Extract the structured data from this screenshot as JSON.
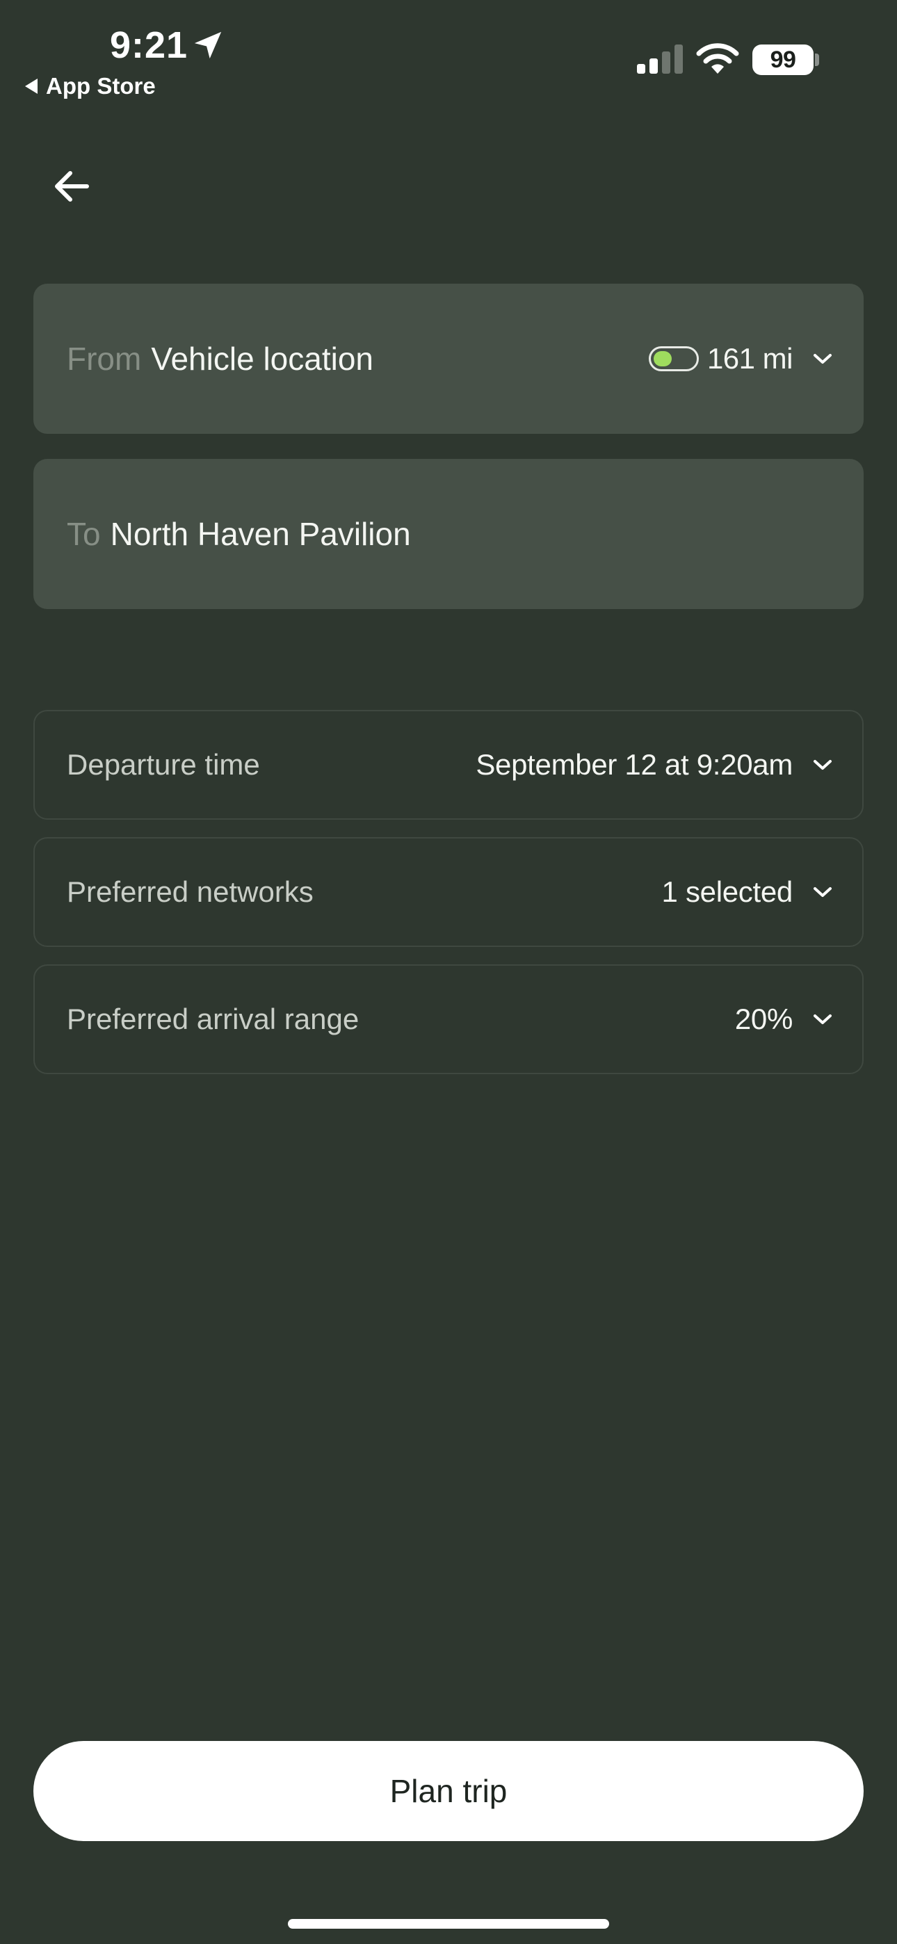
{
  "status_bar": {
    "time": "9:21",
    "back_app": "App Store",
    "battery": "99"
  },
  "trip": {
    "from": {
      "prefix": "From",
      "value": "Vehicle location",
      "range": "161 mi",
      "battery_level_fraction": 0.45,
      "battery_color": "#9fdc5e"
    },
    "to": {
      "prefix": "To",
      "value": "North Haven Pavilion"
    }
  },
  "options": {
    "departure": {
      "label": "Departure time",
      "value": "September 12 at 9:20am"
    },
    "networks": {
      "label": "Preferred networks",
      "value": "1 selected"
    },
    "arrival": {
      "label": "Preferred arrival range",
      "value": "20%"
    }
  },
  "actions": {
    "plan_trip": "Plan trip"
  },
  "icons": {
    "back": "arrow-left-icon",
    "location": "location-arrow-icon",
    "dropdown": "chevron-down-icon",
    "signal": "cellular-signal-icon",
    "wifi": "wifi-icon",
    "battery": "battery-icon"
  },
  "colors": {
    "background": "#2e372f",
    "field": "#465047",
    "row_border": "#3f4840",
    "accent_green": "#9fdc5e"
  }
}
